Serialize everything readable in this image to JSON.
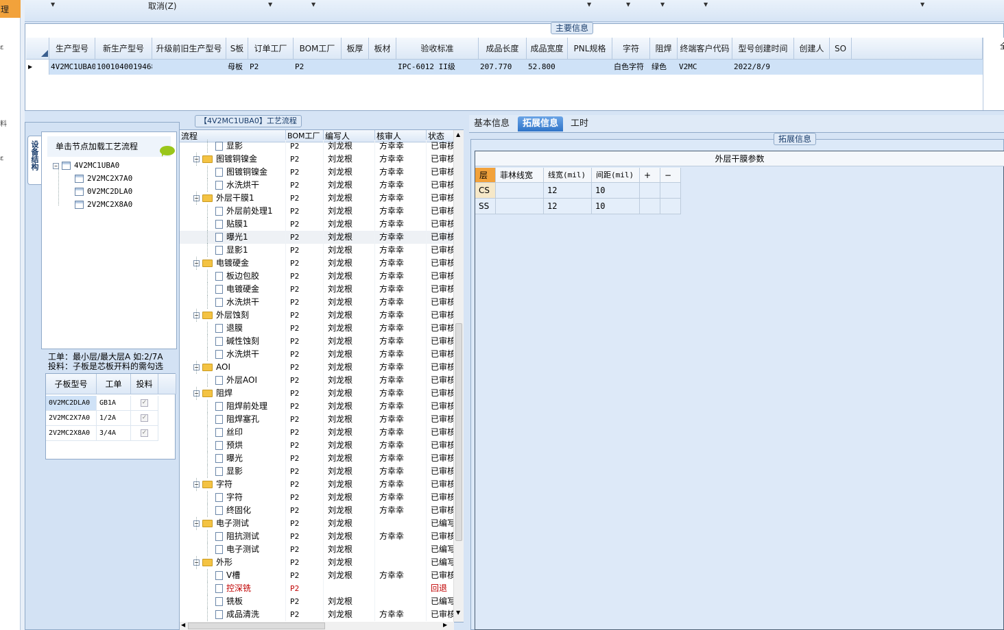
{
  "left_strip": {
    "selected_label": "理",
    "marks": [
      "ε",
      "料",
      "ε"
    ]
  },
  "toolbar": {
    "cancel_label": "取消(Z)"
  },
  "main_info": {
    "group_label": "主要信息",
    "columns": [
      "生产型号",
      "新生产型号",
      "升级前旧生产型号",
      "S板",
      "订单工厂",
      "BOM工厂",
      "板厚",
      "板材",
      "验收标准",
      "成品长度",
      "成品宽度",
      "PNL规格",
      "字符",
      "阻焊",
      "终端客户代码",
      "型号创建时间",
      "创建人",
      "SO"
    ],
    "row": {
      "生产型号": "4V2MC1UBA0",
      "新生产型号": "10010400194688",
      "升级前旧生产型号": "",
      "S板": "母板",
      "订单工厂": "P2",
      "BOM工厂": "P2",
      "板厚": "",
      "板材": "",
      "验收标准": "IPC-6012 II级",
      "成品长度": "207.770",
      "成品宽度": "52.800",
      "PNL规格": "",
      "字符": "白色字符",
      "阻焊": "绿色",
      "终端客户代码": "V2MC",
      "型号创建时间": "2022/8/9",
      "创建人": "",
      "SO": ""
    },
    "right_tab_label": "全"
  },
  "process": {
    "group_label": "【4V2MC1UBA0】工艺流程",
    "vertical_tab": "设备结构",
    "tree_header": "单击节点加载工艺流程",
    "tree": {
      "root": "4V2MC1UBA0",
      "children": [
        "2V2MC2X7A0",
        "0V2MC2DLA0",
        "2V2MC2X8A0"
      ]
    },
    "note_line1": "工单：最小层/最大层A 如:2/7A",
    "note_line2": "投料：子板是芯板开料的需勾选",
    "sub_columns": [
      "子板型号",
      "工单",
      "投料"
    ],
    "sub_rows": [
      {
        "model": "0V2MC2DLA0",
        "order": "GB1A",
        "check": "✓"
      },
      {
        "model": "2V2MC2X7A0",
        "order": "1/2A",
        "check": "✓"
      },
      {
        "model": "2V2MC2X8A0",
        "order": "3/4A",
        "check": "✓"
      }
    ],
    "grid_columns": [
      "流程",
      "BOM工厂",
      "编写人",
      "核审人",
      "状态"
    ],
    "rows": [
      {
        "lvl": 2,
        "name": "显影",
        "bom": "P2",
        "w": "刘龙根",
        "r": "方幸幸",
        "s": "已审核",
        "red": false
      },
      {
        "lvl": 1,
        "name": "图镀铜镍金",
        "bom": "P2",
        "w": "刘龙根",
        "r": "方幸幸",
        "s": "已审核",
        "red": false
      },
      {
        "lvl": 2,
        "name": "图镀铜镍金",
        "bom": "P2",
        "w": "刘龙根",
        "r": "方幸幸",
        "s": "已审核",
        "red": false
      },
      {
        "lvl": 2,
        "name": "水洗烘干",
        "bom": "P2",
        "w": "刘龙根",
        "r": "方幸幸",
        "s": "已审核",
        "red": false
      },
      {
        "lvl": 1,
        "name": "外层干膜1",
        "bom": "P2",
        "w": "刘龙根",
        "r": "方幸幸",
        "s": "已审核",
        "red": false
      },
      {
        "lvl": 2,
        "name": "外层前处理1",
        "bom": "P2",
        "w": "刘龙根",
        "r": "方幸幸",
        "s": "已审核",
        "red": false
      },
      {
        "lvl": 2,
        "name": "贴膜1",
        "bom": "P2",
        "w": "刘龙根",
        "r": "方幸幸",
        "s": "已审核",
        "red": false
      },
      {
        "lvl": 2,
        "name": "曝光1",
        "bom": "P2",
        "w": "刘龙根",
        "r": "方幸幸",
        "s": "已审核",
        "red": false
      },
      {
        "lvl": 2,
        "name": "显影1",
        "bom": "P2",
        "w": "刘龙根",
        "r": "方幸幸",
        "s": "已审核",
        "red": false
      },
      {
        "lvl": 1,
        "name": "电镀硬金",
        "bom": "P2",
        "w": "刘龙根",
        "r": "方幸幸",
        "s": "已审核",
        "red": false
      },
      {
        "lvl": 2,
        "name": "板边包胶",
        "bom": "P2",
        "w": "刘龙根",
        "r": "方幸幸",
        "s": "已审核",
        "red": false
      },
      {
        "lvl": 2,
        "name": "电镀硬金",
        "bom": "P2",
        "w": "刘龙根",
        "r": "方幸幸",
        "s": "已审核",
        "red": false
      },
      {
        "lvl": 2,
        "name": "水洗烘干",
        "bom": "P2",
        "w": "刘龙根",
        "r": "方幸幸",
        "s": "已审核",
        "red": false
      },
      {
        "lvl": 1,
        "name": "外层蚀刻",
        "bom": "P2",
        "w": "刘龙根",
        "r": "方幸幸",
        "s": "已审核",
        "red": false
      },
      {
        "lvl": 2,
        "name": "退膜",
        "bom": "P2",
        "w": "刘龙根",
        "r": "方幸幸",
        "s": "已审核",
        "red": false
      },
      {
        "lvl": 2,
        "name": "碱性蚀刻",
        "bom": "P2",
        "w": "刘龙根",
        "r": "方幸幸",
        "s": "已审核",
        "red": false
      },
      {
        "lvl": 2,
        "name": "水洗烘干",
        "bom": "P2",
        "w": "刘龙根",
        "r": "方幸幸",
        "s": "已审核",
        "red": false
      },
      {
        "lvl": 1,
        "name": "AOI",
        "bom": "P2",
        "w": "刘龙根",
        "r": "方幸幸",
        "s": "已审核",
        "red": false
      },
      {
        "lvl": 2,
        "name": "外层AOI",
        "bom": "P2",
        "w": "刘龙根",
        "r": "方幸幸",
        "s": "已审核",
        "red": false
      },
      {
        "lvl": 1,
        "name": "阻焊",
        "bom": "P2",
        "w": "刘龙根",
        "r": "方幸幸",
        "s": "已审核",
        "red": false
      },
      {
        "lvl": 2,
        "name": "阻焊前处理",
        "bom": "P2",
        "w": "刘龙根",
        "r": "方幸幸",
        "s": "已审核",
        "red": false
      },
      {
        "lvl": 2,
        "name": "阻焊塞孔",
        "bom": "P2",
        "w": "刘龙根",
        "r": "方幸幸",
        "s": "已审核",
        "red": false
      },
      {
        "lvl": 2,
        "name": "丝印",
        "bom": "P2",
        "w": "刘龙根",
        "r": "方幸幸",
        "s": "已审核",
        "red": false
      },
      {
        "lvl": 2,
        "name": "预烘",
        "bom": "P2",
        "w": "刘龙根",
        "r": "方幸幸",
        "s": "已审核",
        "red": false
      },
      {
        "lvl": 2,
        "name": "曝光",
        "bom": "P2",
        "w": "刘龙根",
        "r": "方幸幸",
        "s": "已审核",
        "red": false
      },
      {
        "lvl": 2,
        "name": "显影",
        "bom": "P2",
        "w": "刘龙根",
        "r": "方幸幸",
        "s": "已审核",
        "red": false
      },
      {
        "lvl": 1,
        "name": "字符",
        "bom": "P2",
        "w": "刘龙根",
        "r": "方幸幸",
        "s": "已审核",
        "red": false
      },
      {
        "lvl": 2,
        "name": "字符",
        "bom": "P2",
        "w": "刘龙根",
        "r": "方幸幸",
        "s": "已审核",
        "red": false
      },
      {
        "lvl": 2,
        "name": "终固化",
        "bom": "P2",
        "w": "刘龙根",
        "r": "方幸幸",
        "s": "已审核",
        "red": false
      },
      {
        "lvl": 1,
        "name": "电子测试",
        "bom": "P2",
        "w": "刘龙根",
        "r": "",
        "s": "已编写",
        "red": false
      },
      {
        "lvl": 2,
        "name": "阻抗测试",
        "bom": "P2",
        "w": "刘龙根",
        "r": "方幸幸",
        "s": "已审核",
        "red": false
      },
      {
        "lvl": 2,
        "name": "电子测试",
        "bom": "P2",
        "w": "刘龙根",
        "r": "",
        "s": "已编写",
        "red": false
      },
      {
        "lvl": 1,
        "name": "外形",
        "bom": "P2",
        "w": "刘龙根",
        "r": "",
        "s": "已编写",
        "red": false
      },
      {
        "lvl": 2,
        "name": "V槽",
        "bom": "P2",
        "w": "刘龙根",
        "r": "方幸幸",
        "s": "已审核",
        "red": false
      },
      {
        "lvl": 2,
        "name": "控深铣",
        "bom": "P2",
        "w": "",
        "r": "",
        "s": "回退",
        "red": true
      },
      {
        "lvl": 2,
        "name": "铣板",
        "bom": "P2",
        "w": "刘龙根",
        "r": "",
        "s": "已编写",
        "red": false
      },
      {
        "lvl": 2,
        "name": "成品清洗",
        "bom": "P2",
        "w": "刘龙根",
        "r": "方幸幸",
        "s": "已审核",
        "red": false
      }
    ]
  },
  "right_tabs": [
    {
      "label": "基本信息",
      "active": false
    },
    {
      "label": "拓展信息",
      "active": true
    },
    {
      "label": "工时",
      "active": false
    }
  ],
  "ext": {
    "group_label": "拓展信息",
    "title": "外层干膜参数",
    "columns": [
      "层",
      "菲林线宽",
      "线宽(mil)",
      "间距(mil)",
      "+",
      "−"
    ],
    "rows": [
      {
        "layer": "CS",
        "film": "",
        "width": "12",
        "gap": "10"
      },
      {
        "layer": "SS",
        "film": "",
        "width": "12",
        "gap": "10"
      }
    ]
  },
  "colors": {
    "selected_row": "#cfe2f7",
    "active_tab": "#2f74c8",
    "reject_red": "#c00000",
    "folder": "#f4c343",
    "layer_header": "#f2a23b"
  }
}
